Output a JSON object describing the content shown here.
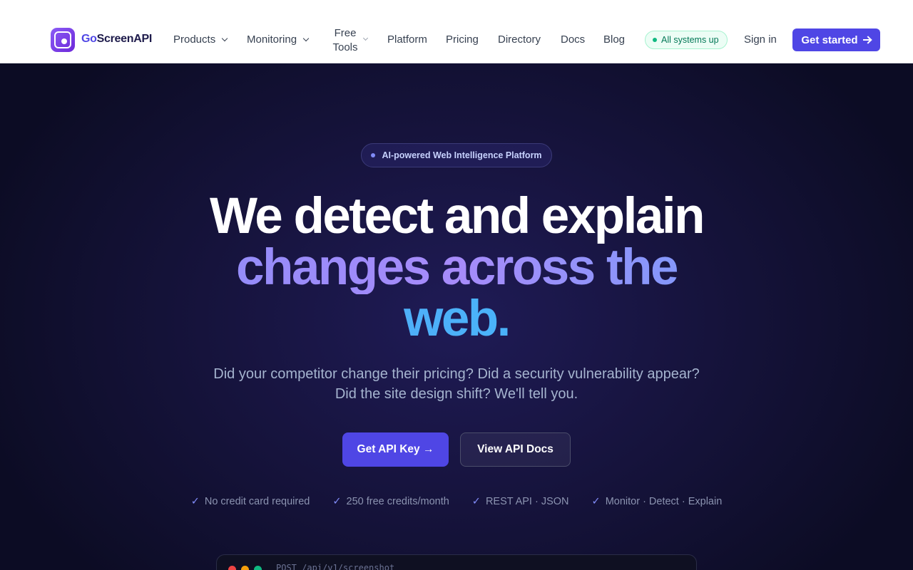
{
  "nav": {
    "brand_prefix": "Go",
    "brand_suffix": "ScreenAPI",
    "items": [
      {
        "label": "Products",
        "has_dropdown": true
      },
      {
        "label": "Monitoring",
        "has_dropdown": true
      },
      {
        "label": "Free Tools",
        "has_dropdown": true
      },
      {
        "label": "Platform"
      },
      {
        "label": "Pricing"
      },
      {
        "label": "Directory"
      },
      {
        "label": "Docs"
      },
      {
        "label": "Blog"
      }
    ],
    "status": "All systems up",
    "sign_in": "Sign in",
    "cta": "Get started"
  },
  "hero": {
    "badge": "AI-powered Web Intelligence Platform",
    "headline_line1": "We detect and explain",
    "headline_line2": "changes across the",
    "headline_line3": "web.",
    "subheadline": "Did your competitor change their pricing? Did a security vulnerability appear? Did the site design shift? We'll tell you.",
    "primary_button": "Get API Key →",
    "secondary_button": "View API Docs",
    "features": [
      "No credit card required",
      "250 free credits/month",
      "REST API · JSON",
      "Monitor · Detect · Explain"
    ],
    "check_glyph": "✓"
  },
  "terminal": {
    "command": "POST /api/v1/screenshot"
  },
  "colors": {
    "accent": "#4f46e5",
    "hero_bg": "#17143f",
    "status_green": "#10b981"
  }
}
